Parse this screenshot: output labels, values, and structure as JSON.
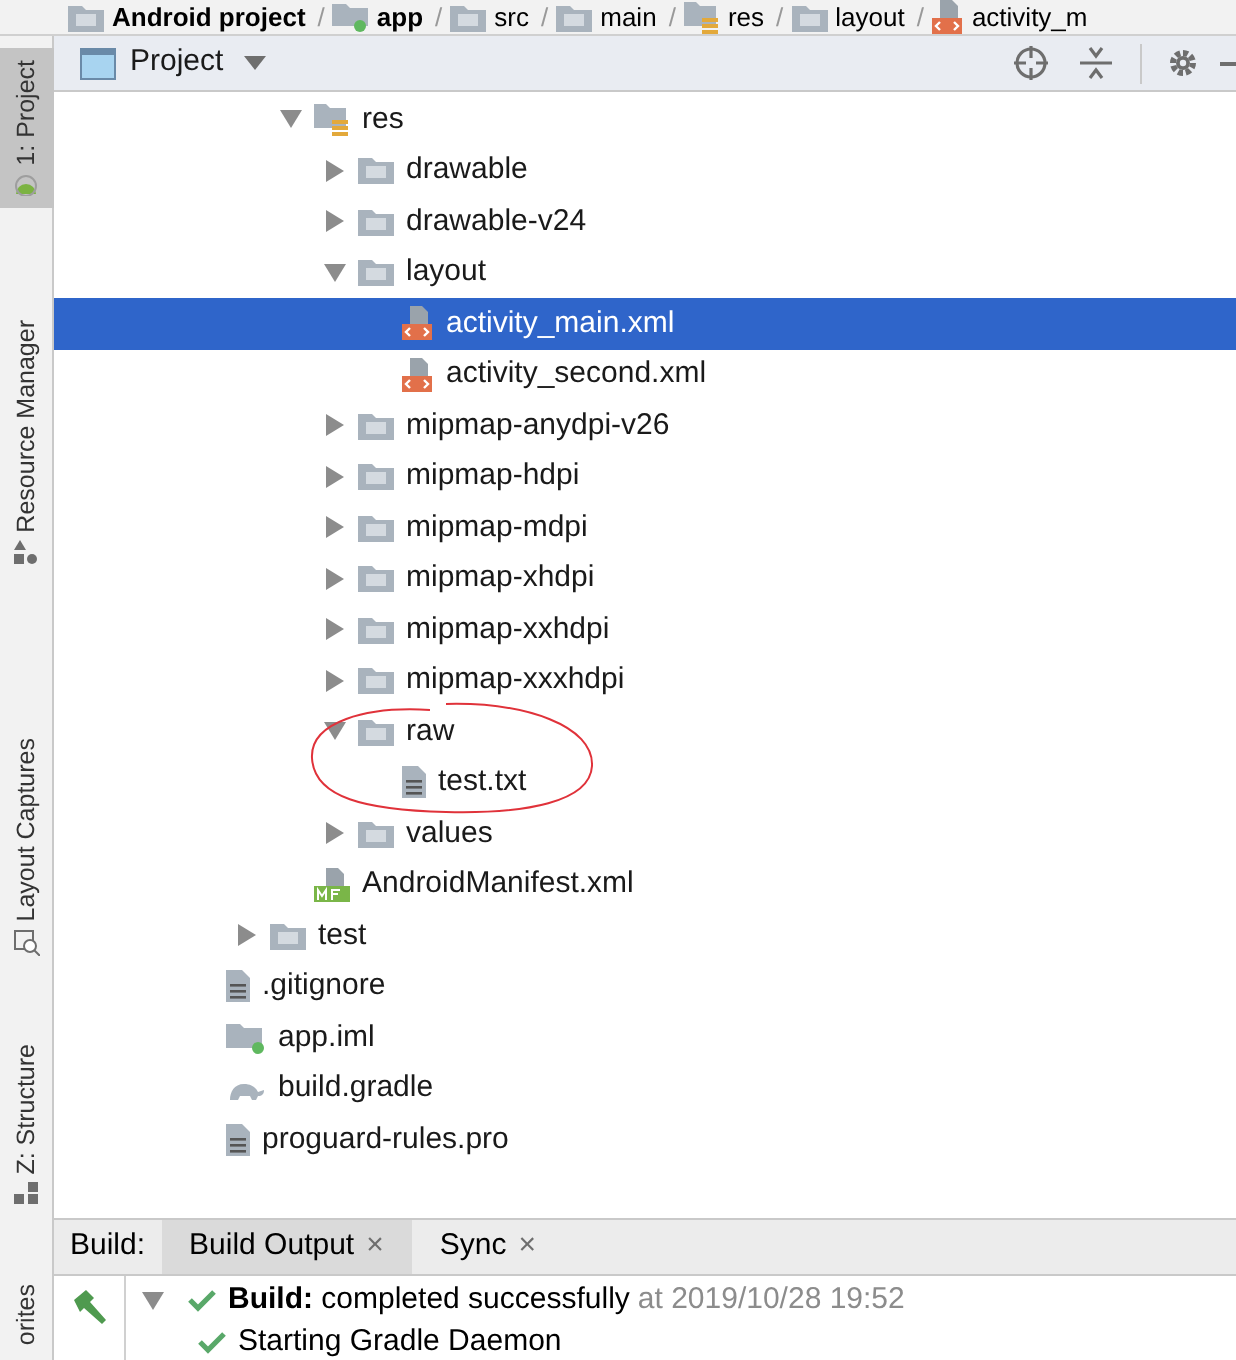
{
  "breadcrumb": {
    "separator": "/",
    "items": [
      {
        "label": "Android project",
        "kind": "project",
        "bold": true
      },
      {
        "label": "app",
        "kind": "module",
        "bold": true
      },
      {
        "label": "src",
        "kind": "folder",
        "bold": false
      },
      {
        "label": "main",
        "kind": "folder",
        "bold": false
      },
      {
        "label": "res",
        "kind": "res-folder",
        "bold": false
      },
      {
        "label": "layout",
        "kind": "folder",
        "bold": false
      },
      {
        "label": "activity_m",
        "kind": "layout-file",
        "bold": false
      }
    ]
  },
  "side_tabs": [
    {
      "label": "1: Project",
      "kind": "android",
      "selected": true
    },
    {
      "label": "Resource Manager",
      "kind": "resources",
      "selected": false
    },
    {
      "label": "Layout Captures",
      "kind": "captures",
      "selected": false
    },
    {
      "label": "Z: Structure",
      "kind": "structure",
      "selected": false
    },
    {
      "label": "orites",
      "kind": "none",
      "selected": false
    }
  ],
  "panel": {
    "title": "Project"
  },
  "tree": [
    {
      "children": [
        {
          "children": [
            {
              "label": "res",
              "kind": "res-folder",
              "expanded": true,
              "selected": false,
              "circled": false,
              "children": [
                {
                  "label": "drawable",
                  "kind": "folder",
                  "expanded": false,
                  "selected": false,
                  "circled": false
                },
                {
                  "label": "drawable-v24",
                  "kind": "folder",
                  "expanded": false,
                  "selected": false,
                  "circled": false
                },
                {
                  "label": "layout",
                  "kind": "folder",
                  "expanded": true,
                  "selected": false,
                  "circled": false,
                  "children": [
                    {
                      "label": "activity_main.xml",
                      "kind": "layout-file",
                      "selected": true,
                      "circled": false
                    },
                    {
                      "label": "activity_second.xml",
                      "kind": "layout-file",
                      "selected": false,
                      "circled": false
                    }
                  ]
                },
                {
                  "label": "mipmap-anydpi-v26",
                  "kind": "folder",
                  "expanded": false,
                  "selected": false,
                  "circled": false
                },
                {
                  "label": "mipmap-hdpi",
                  "kind": "folder",
                  "expanded": false,
                  "selected": false,
                  "circled": false
                },
                {
                  "label": "mipmap-mdpi",
                  "kind": "folder",
                  "expanded": false,
                  "selected": false,
                  "circled": false
                },
                {
                  "label": "mipmap-xhdpi",
                  "kind": "folder",
                  "expanded": false,
                  "selected": false,
                  "circled": false
                },
                {
                  "label": "mipmap-xxhdpi",
                  "kind": "folder",
                  "expanded": false,
                  "selected": false,
                  "circled": false
                },
                {
                  "label": "mipmap-xxxhdpi",
                  "kind": "folder",
                  "expanded": false,
                  "selected": false,
                  "circled": false
                },
                {
                  "label": "raw",
                  "kind": "folder",
                  "expanded": true,
                  "selected": false,
                  "circled": true,
                  "children": [
                    {
                      "label": "test.txt",
                      "kind": "text-file",
                      "selected": false,
                      "circled": false
                    }
                  ]
                },
                {
                  "label": "values",
                  "kind": "folder",
                  "expanded": false,
                  "selected": false,
                  "circled": false
                }
              ]
            },
            {
              "label": "AndroidManifest.xml",
              "kind": "manifest-file",
              "selected": false,
              "circled": false
            }
          ]
        },
        {
          "label": "test",
          "kind": "folder",
          "expanded": false,
          "selected": false,
          "circled": false
        }
      ]
    },
    {
      "label": ".gitignore",
      "kind": "text-file",
      "selected": false,
      "circled": false
    },
    {
      "label": "app.iml",
      "kind": "module-file",
      "selected": false,
      "circled": false
    },
    {
      "label": "build.gradle",
      "kind": "gradle-file",
      "selected": false,
      "circled": false
    },
    {
      "label": "proguard-rules.pro",
      "kind": "text-file",
      "selected": false,
      "circled": false
    }
  ],
  "build": {
    "label": "Build:",
    "tabs": [
      {
        "label": "Build Output",
        "selected": true,
        "close": "×"
      },
      {
        "label": "Sync",
        "selected": false,
        "close": "×"
      }
    ],
    "rows": [
      {
        "message": "**Build:** completed successfully",
        "time": "at 2019/10/28 19:52",
        "expanded": true,
        "children": [
          {
            "message": "Starting Gradle Daemon"
          }
        ]
      }
    ]
  }
}
